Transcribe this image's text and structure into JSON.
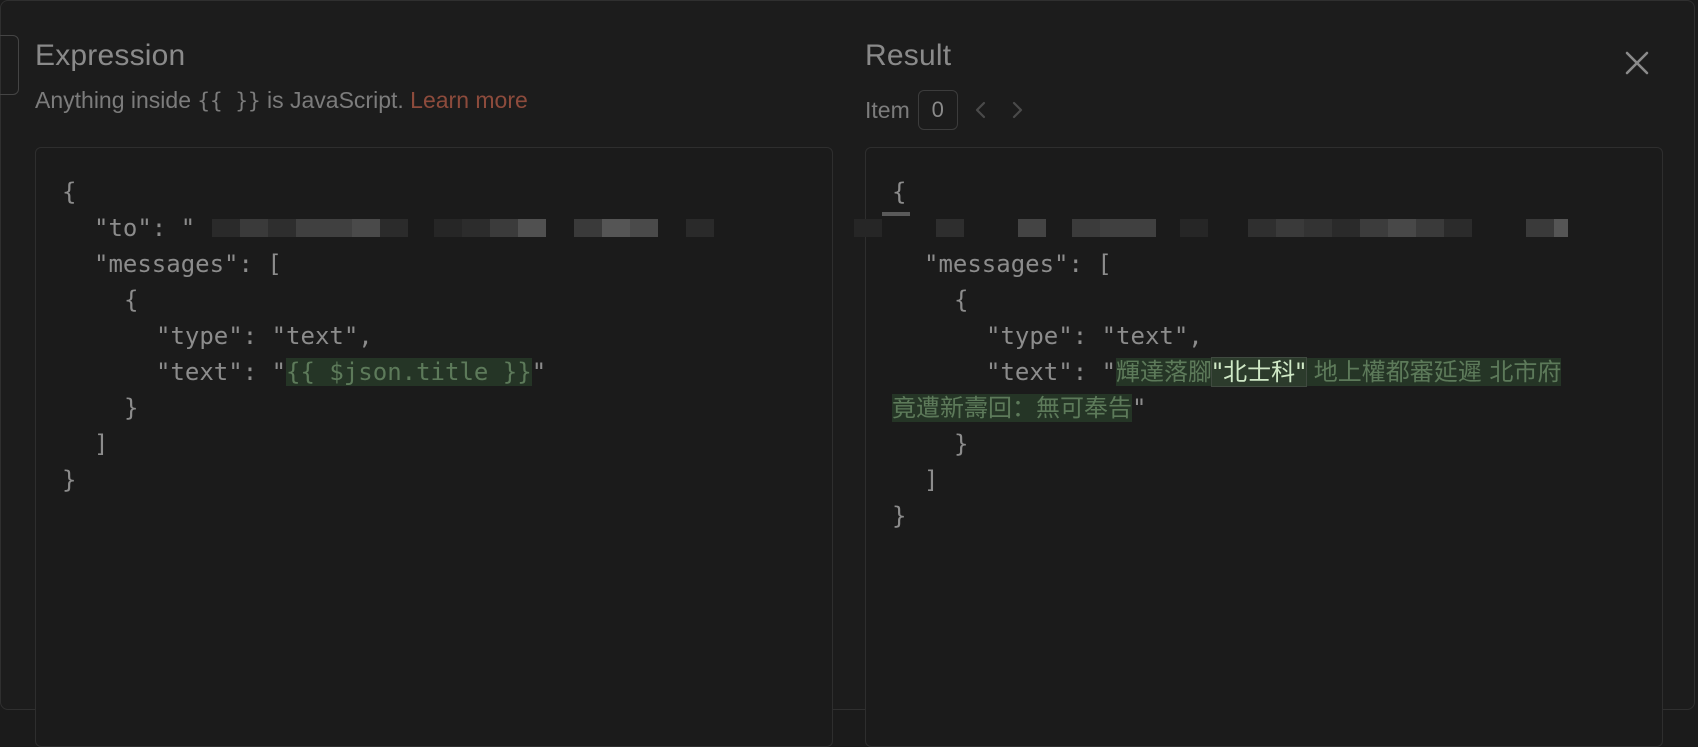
{
  "expression": {
    "title": "Expression",
    "subtitle_before": "Anything inside",
    "subtitle_braces": "{{ }}",
    "subtitle_after": "is JavaScript.",
    "learn_more": "Learn more",
    "code": {
      "open_brace": "{",
      "to_key": "\"to\": \"",
      "to_comma": ",",
      "messages_key": "\"messages\": [",
      "item_open": "{",
      "type_line": "\"type\": \"text\",",
      "text_prefix": "\"text\": \"",
      "text_expr": "{{ $json.title }}",
      "text_suffix": "\"",
      "item_close": "}",
      "array_close": "]",
      "close_brace": "}"
    }
  },
  "result": {
    "title": "Result",
    "item_label": "Item",
    "item_value": "0",
    "code": {
      "open_brace": "{",
      "messages_key": "\"messages\": [",
      "item_open": "{",
      "type_line": "\"type\": \"text\",",
      "text_prefix": "\"text\": \"",
      "text_part1": "輝達落腳",
      "text_highlight": "\"北士科\"",
      "text_part2": " 地上權都審延遲 北市府",
      "text_part3": "竟遭新壽回：無可奉告",
      "text_suffix": "\"",
      "item_close": "}",
      "array_close": "]",
      "close_brace": "}"
    }
  },
  "icons": {
    "close": "close-icon",
    "prev": "chevron-left-icon",
    "next": "chevron-right-icon"
  },
  "colors": {
    "background": "#1c1c1c",
    "link": "#8d4b3c",
    "highlight_bg": "#253526",
    "highlight_text": "#5d7a5a"
  }
}
